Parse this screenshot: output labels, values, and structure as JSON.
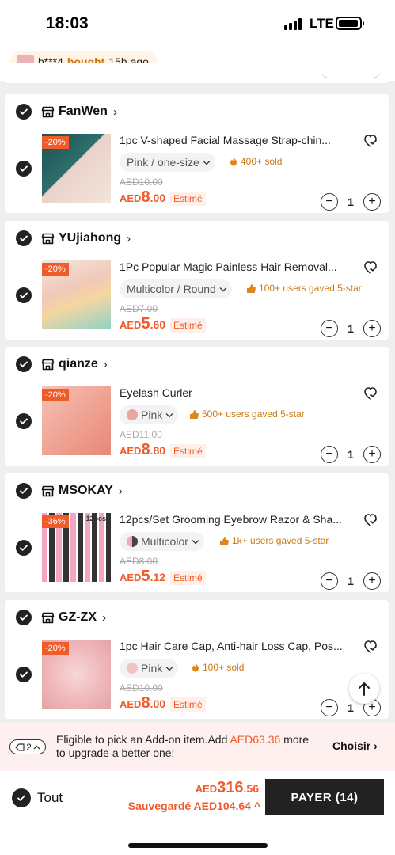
{
  "status_bar": {
    "time": "18:03",
    "network": "LTE"
  },
  "notice": {
    "user": "b***4",
    "action": "bought",
    "when": "15h ago"
  },
  "stores": [
    {
      "name": "FanWen",
      "product": {
        "title": "1pc V-shaped Facial Massage Strap-chin...",
        "discount": "-20%",
        "variant": "Pink / one-size",
        "badge": "400+ sold",
        "badge_icon": "fire-icon",
        "original_price": "AED10.00",
        "currency": "AED",
        "price_int": "8",
        "price_dec": ".00",
        "estimate": "Estimé",
        "qty": "1"
      }
    },
    {
      "name": "YUjiahong",
      "product": {
        "title": "1Pc Popular Magic Painless Hair Removal...",
        "discount": "-20%",
        "variant": "Multicolor / Round",
        "badge": "100+ users gaved 5-star",
        "badge_icon": "thumbs-up-icon",
        "original_price": "AED7.00",
        "currency": "AED",
        "price_int": "5",
        "price_dec": ".60",
        "estimate": "Estimé",
        "qty": "1"
      }
    },
    {
      "name": "qianze",
      "product": {
        "title": "Eyelash Curler",
        "discount": "-20%",
        "variant": "Pink",
        "badge": "500+ users gaved 5-star",
        "badge_icon": "thumbs-up-icon",
        "original_price": "AED11.00",
        "currency": "AED",
        "price_int": "8",
        "price_dec": ".80",
        "estimate": "Estimé",
        "qty": "1"
      }
    },
    {
      "name": "MSOKAY",
      "product": {
        "title": "12pcs/Set Grooming Eyebrow Razor & Sha...",
        "discount": "-36%",
        "image_text": "12pcs",
        "variant": "Multicolor",
        "badge": "1k+ users gaved 5-star",
        "badge_icon": "thumbs-up-icon",
        "original_price": "AED8.00",
        "currency": "AED",
        "price_int": "5",
        "price_dec": ".12",
        "estimate": "Estimé",
        "qty": "1"
      }
    },
    {
      "name": "GZ-ZX",
      "product": {
        "title": "1pc Hair Care Cap, Anti-hair Loss Cap, Pos...",
        "discount": "-20%",
        "variant": "Pink",
        "badge": "100+ sold",
        "badge_icon": "fire-icon",
        "original_price": "AED10.00",
        "currency": "AED",
        "price_int": "8",
        "price_dec": ".00",
        "estimate": "Estimé",
        "qty": "1"
      }
    }
  ],
  "addon": {
    "coupon_count": "2",
    "text_before": "Eligible to pick an Add-on item.Add ",
    "amount": "AED63.36",
    "text_after": " more to upgrade a better one!",
    "choose_label": "Choisir"
  },
  "footer": {
    "select_all_label": "Tout",
    "currency": "AED",
    "total_int": "316",
    "total_dec": ".56",
    "saved_label": "Sauvegardé AED104.64",
    "pay_label": "PAYER (14)"
  },
  "colors": {
    "accent": "#f15a29",
    "badge": "#c97a14",
    "dark": "#222222"
  }
}
